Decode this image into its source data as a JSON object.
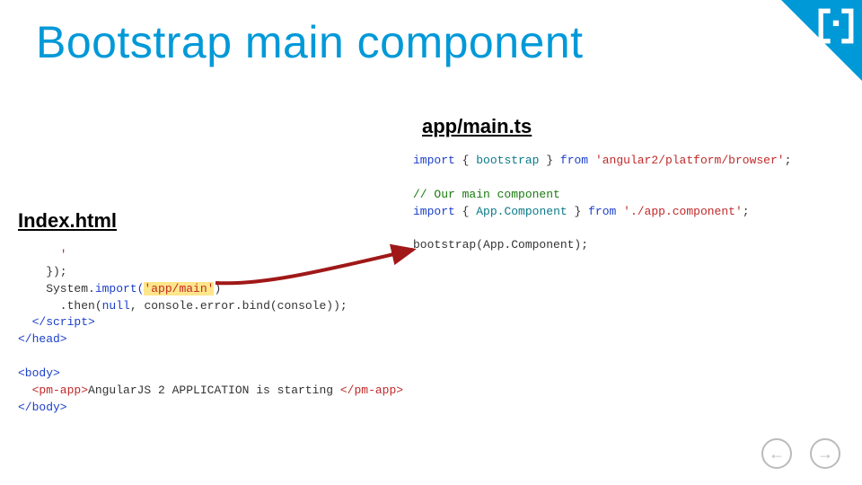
{
  "title": "Bootstrap main component",
  "subtitle_right": "app/main.ts",
  "subtitle_left": "Index.html",
  "code_right": {
    "l1_import": "import",
    "l1_brace_open": "{",
    "l1_sym": "bootstrap",
    "l1_brace_close": "}",
    "l1_from": "from",
    "l1_path": "'angular2/platform/browser'",
    "l1_semi": ";",
    "l2_comment": "// Our main component",
    "l3_import": "import",
    "l3_brace_open": "{",
    "l3_sym": "App.Component",
    "l3_brace_close": "}",
    "l3_from": "from",
    "l3_path": "'./app.component'",
    "l3_semi": ";",
    "l4_call": "bootstrap(App.Component);"
  },
  "code_left": {
    "l0_tail": "      '",
    "l1_close": "    });",
    "l2_sys": "    System.",
    "l2_import": "import(",
    "l2_arg": "'app/main'",
    "l2_close": ")",
    "l3_then": "      .then(",
    "l3_null": "null",
    "l3_rest": ", console.error.bind(console));",
    "l4_scr_close": "  </script",
    "l4_gt": ">",
    "l5_head_close": "</head>",
    "l6_body_open": "<body>",
    "l7_pm_open": "  <pm-app>",
    "l7_text": "AngularJS 2 APPLICATION is starting ",
    "l7_pm_close": "</pm-app>",
    "l8_body_close": "</body>"
  },
  "nav": {
    "prev": "←",
    "next": "→"
  }
}
